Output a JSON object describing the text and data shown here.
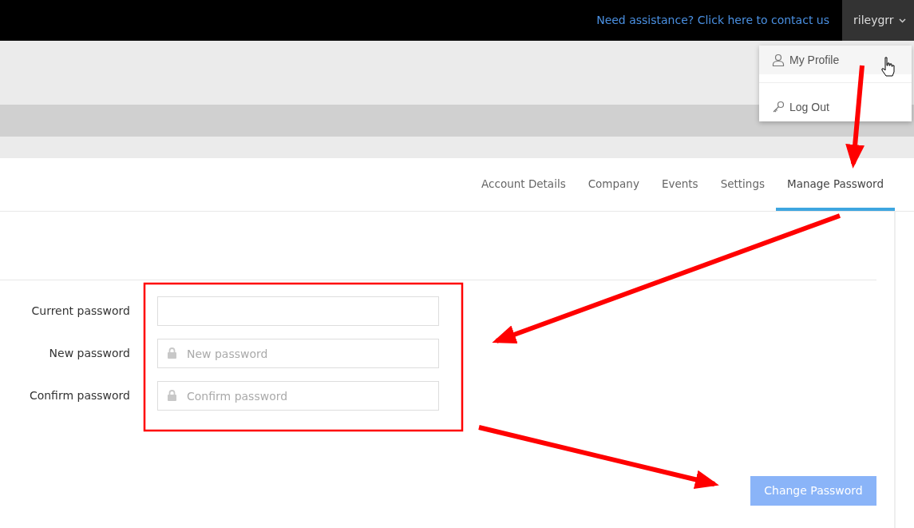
{
  "top_bar": {
    "help_link": "Need assistance? Click here to contact us",
    "user_menu": {
      "username": "rileygrr",
      "expanded": true
    }
  },
  "user_dropdown": [
    {
      "label": "My Profile",
      "kind": "profile",
      "hovered": true
    },
    {
      "label": "Log Out",
      "kind": "logout",
      "hovered": false
    }
  ],
  "tabs": [
    {
      "label": "Account Details",
      "selected": false
    },
    {
      "label": "Company",
      "selected": false
    },
    {
      "label": "Events",
      "selected": false
    },
    {
      "label": "Settings",
      "selected": false
    },
    {
      "label": "Manage Password",
      "selected": true
    }
  ],
  "form": {
    "fields": [
      {
        "label": "Current password",
        "locked": false
      },
      {
        "label": "New password",
        "placeholder": "New password",
        "locked": true
      },
      {
        "label": "Confirm password",
        "placeholder": "Confirm password",
        "locked": true
      }
    ],
    "submit": {
      "label": "Change Password",
      "disabled": true
    }
  }
}
